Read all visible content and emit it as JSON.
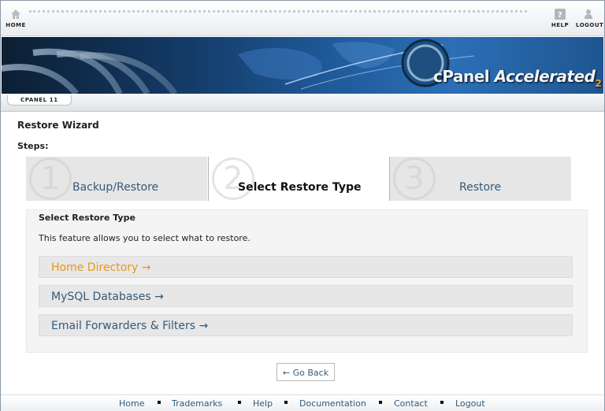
{
  "topbar": {
    "home_label": "HOME",
    "help_label": "HELP",
    "logout_label": "LOGOUT"
  },
  "banner": {
    "brand_c": "c",
    "brand_panel": "Panel",
    "brand_accelerated": "Accelerated",
    "brand_version": "2"
  },
  "tabstrip": {
    "tab_label": "CPANEL 11"
  },
  "page": {
    "title": "Restore Wizard",
    "steps_label": "Steps:"
  },
  "steps": [
    {
      "number": "1",
      "label": "Backup/Restore",
      "active": false
    },
    {
      "number": "2",
      "label": "Select Restore Type",
      "active": true
    },
    {
      "number": "3",
      "label": "Restore",
      "active": false
    }
  ],
  "panel": {
    "heading": "Select Restore Type",
    "description": "This feature allows you to select what to restore.",
    "options": [
      {
        "label": "Home Directory →",
        "highlighted": true
      },
      {
        "label": "MySQL Databases →",
        "highlighted": false
      },
      {
        "label": "Email Forwarders & Filters →",
        "highlighted": false
      }
    ]
  },
  "go_back_label": "← Go Back",
  "footer": {
    "links": [
      "Home",
      "Trademarks",
      "Help",
      "Documentation",
      "Contact",
      "Logout"
    ]
  },
  "colors": {
    "link": "#335a7a",
    "highlight": "#e8961c",
    "banner_dark": "#0c1f33",
    "banner_light": "#2c6fb6"
  },
  "icons": {
    "home": "house-icon",
    "help": "question-icon",
    "logout": "person-icon"
  }
}
